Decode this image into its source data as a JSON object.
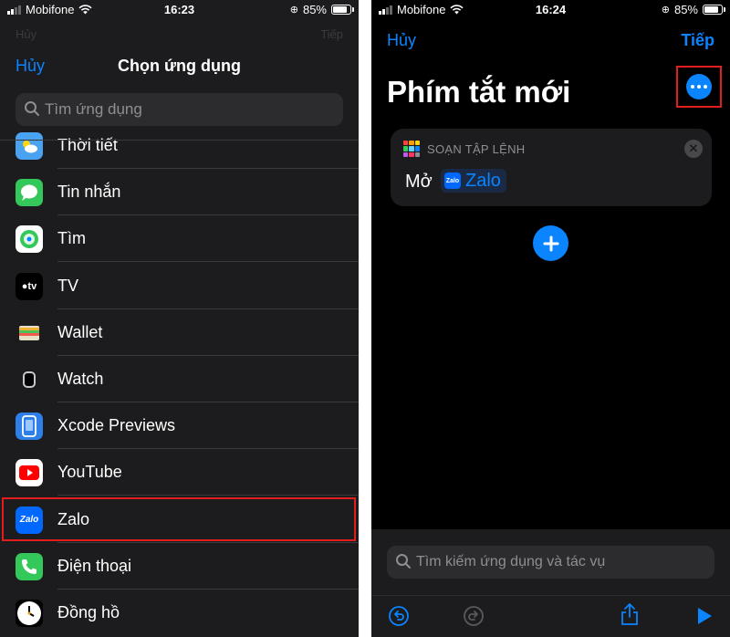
{
  "left": {
    "status": {
      "carrier": "Mobifone",
      "time": "16:23",
      "battery": "85%"
    },
    "ghost_left": "Hủy",
    "ghost_right": "Tiếp",
    "cancel_label": "Hủy",
    "title": "Chọn ứng dụng",
    "search_placeholder": "Tìm ứng dụng",
    "apps": [
      {
        "label": "Thời tiết",
        "icon": "weather-icon",
        "color": "#4aa3f0"
      },
      {
        "label": "Tin nhắn",
        "icon": "messages-icon",
        "color": "#34c759"
      },
      {
        "label": "Tìm",
        "icon": "find-my-icon",
        "color": "#ffffff"
      },
      {
        "label": "TV",
        "icon": "apple-tv-icon",
        "color": "#000000"
      },
      {
        "label": "Wallet",
        "icon": "wallet-icon",
        "color": "#1c1c1e"
      },
      {
        "label": "Watch",
        "icon": "watch-icon",
        "color": "#1c1c1e"
      },
      {
        "label": "Xcode Previews",
        "icon": "xcode-previews-icon",
        "color": "#2f7fe8"
      },
      {
        "label": "YouTube",
        "icon": "youtube-icon",
        "color": "#ffffff"
      },
      {
        "label": "Zalo",
        "icon": "zalo-icon",
        "color": "#0068ff",
        "icon_text": "Zalo"
      },
      {
        "label": "Điện thoại",
        "icon": "phone-icon",
        "color": "#34c759"
      },
      {
        "label": "Đồng hồ",
        "icon": "clock-icon",
        "color": "#000000"
      }
    ]
  },
  "right": {
    "status": {
      "carrier": "Mobifone",
      "time": "16:24",
      "battery": "85%"
    },
    "cancel_label": "Hủy",
    "next_label": "Tiếp",
    "title": "Phím tắt mới",
    "card": {
      "title": "SOẠN TẬP LỆNH",
      "action": "Mở",
      "app": "Zalo",
      "app_icon_text": "Zalo"
    },
    "search_placeholder": "Tìm kiếm ứng dụng và tác vụ"
  },
  "colors": {
    "accent": "#0a84ff",
    "highlight": "#e01e1e"
  }
}
